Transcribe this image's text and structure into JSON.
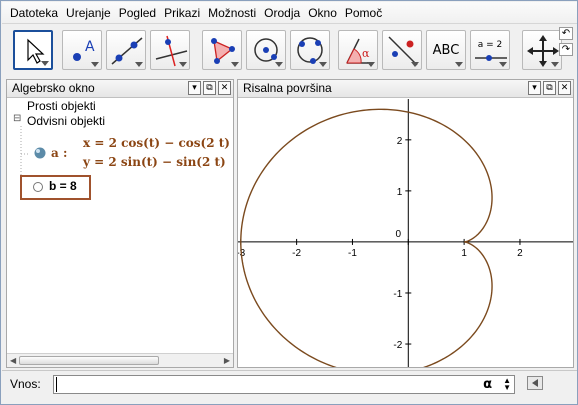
{
  "menu": [
    "Datoteka",
    "Urejanje",
    "Pogled",
    "Prikazi",
    "Možnosti",
    "Orodja",
    "Okno",
    "Pomoč"
  ],
  "toolbar": {
    "tools": [
      {
        "name": "move-tool",
        "icon": "cursor-arrow-icon",
        "active": true
      },
      {
        "name": "point-tool",
        "icon": "point-a-icon"
      },
      {
        "name": "line-tool",
        "icon": "line-through-points-icon"
      },
      {
        "name": "perpendicular-tool",
        "icon": "perpendicular-line-icon"
      },
      {
        "name": "polygon-tool",
        "icon": "polygon-icon"
      },
      {
        "name": "circle-center-tool",
        "icon": "circle-center-point-icon"
      },
      {
        "name": "circle-three-points-tool",
        "icon": "circle-three-points-icon"
      },
      {
        "name": "angle-tool",
        "icon": "angle-alpha-icon"
      },
      {
        "name": "reflect-tool",
        "icon": "reflect-line-icon"
      },
      {
        "name": "text-tool",
        "icon": "text-abc-icon",
        "label": "ABC"
      },
      {
        "name": "slider-tool",
        "icon": "slider-icon",
        "label": "a = 2"
      },
      {
        "name": "move-view-tool",
        "icon": "move-graphics-view-icon"
      }
    ]
  },
  "algebra": {
    "title": "Algebrsko okno",
    "free_label": "Prosti objekti",
    "dependent_label": "Odvisni objekti",
    "object_a": {
      "name": "a :",
      "line1": "x = 2 cos(t) − cos(2 t)",
      "line2": "y = 2 sin(t) − sin(2 t)"
    },
    "object_b": {
      "text": "b = 8"
    }
  },
  "graphics": {
    "title": "Risalna površina"
  },
  "input": {
    "label": "Vnos:",
    "value": "",
    "alpha": "α"
  },
  "colors": {
    "curve": "#7b4a1e",
    "highlight_box": "#a0522d",
    "active_tool_border": "#1b4f9b"
  },
  "chart_data": {
    "type": "line",
    "curve": "cardioid x = 2cos(t) - cos(2t), y = 2sin(t) - sin(2t)",
    "xlim": [
      -3.05,
      2.95
    ],
    "ylim": [
      -2.45,
      2.8
    ],
    "xticks": [
      -3,
      -2,
      -1,
      0,
      1,
      2
    ],
    "yticks": [
      -2,
      -1,
      1,
      2
    ],
    "xtick_labels": [
      "-3",
      "-2",
      "-1",
      "0",
      "1",
      "2"
    ],
    "ytick_labels": [
      "-2",
      "-1",
      "1",
      "2"
    ],
    "grid": false
  }
}
